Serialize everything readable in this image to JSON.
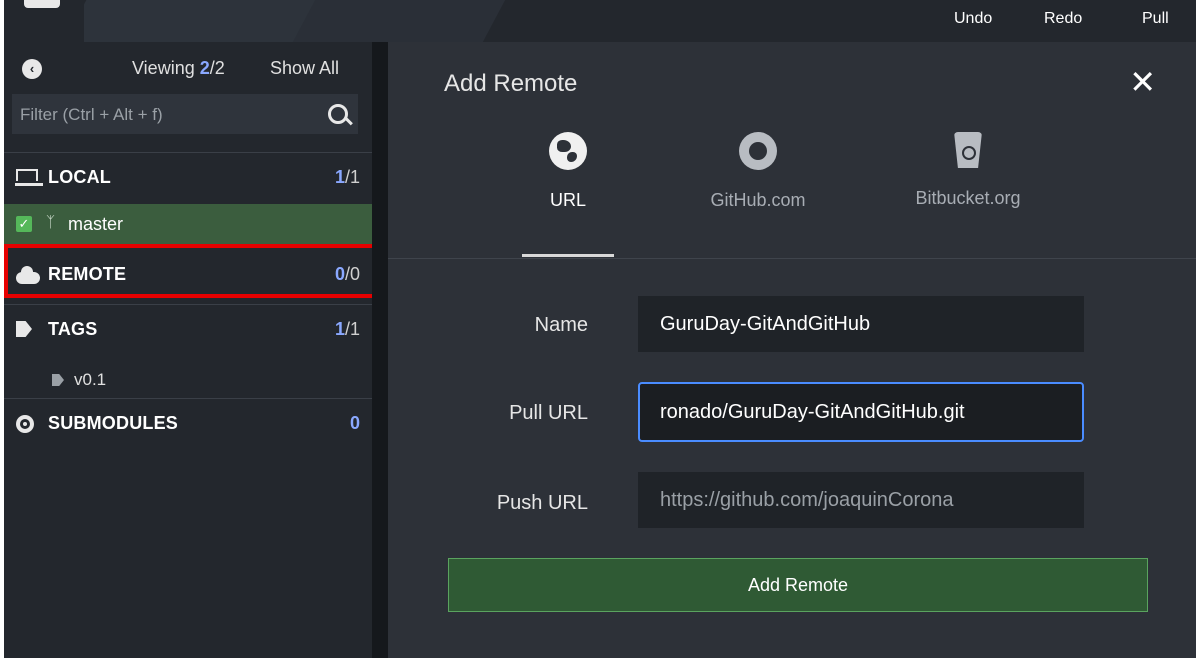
{
  "topbar": {
    "undo": "Undo",
    "redo": "Redo",
    "pull": "Pull"
  },
  "sidebar": {
    "viewing_label": "Viewing",
    "viewing_count": "2",
    "viewing_total": "/2",
    "show_all": "Show All",
    "filter_placeholder": "Filter (Ctrl + Alt + f)",
    "sections": {
      "local": {
        "label": "LOCAL",
        "count": "1",
        "total": "/1"
      },
      "remote": {
        "label": "REMOTE",
        "count": "0",
        "total": "/0"
      },
      "tags": {
        "label": "TAGS",
        "count": "1",
        "total": "/1"
      },
      "submodules": {
        "label": "SUBMODULES",
        "count": "0"
      }
    },
    "branch": {
      "name": "master"
    },
    "tag_item": {
      "name": "v0.1"
    }
  },
  "panel": {
    "title": "Add Remote",
    "tabs": [
      {
        "label": "URL",
        "icon": "globe-icon"
      },
      {
        "label": "GitHub.com",
        "icon": "github-icon"
      },
      {
        "label": "Bitbucket.org",
        "icon": "bitbucket-icon"
      }
    ],
    "form": {
      "name_label": "Name",
      "name_value": "GuruDay-GitAndGitHub",
      "pull_label": "Pull URL",
      "pull_value": "ronado/GuruDay-GitAndGitHub.git",
      "push_label": "Push URL",
      "push_placeholder": "https://github.com/joaquinCorona"
    },
    "submit": "Add Remote"
  },
  "colors": {
    "accent_blue": "#8aa8ff",
    "branch_active": "#3b5d3e",
    "highlight": "#e60000",
    "focus": "#4a8cff"
  }
}
